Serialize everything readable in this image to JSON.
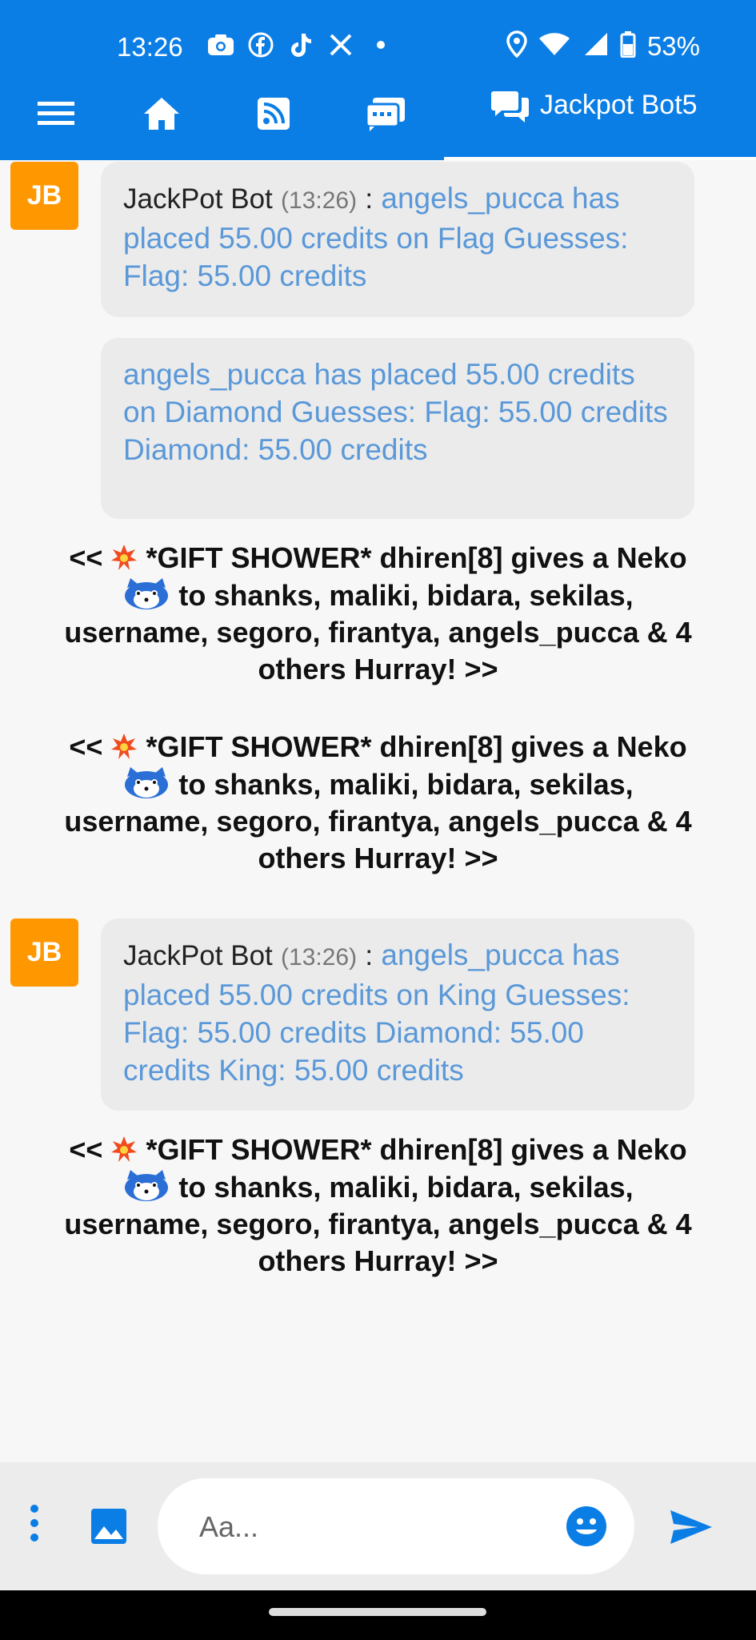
{
  "status": {
    "time": "13:26",
    "battery": "53%"
  },
  "header": {
    "room_title": "Jackpot Bot5"
  },
  "messages": [
    {
      "avatar": "JB",
      "sender": "JackPot Bot",
      "time": "(13:26)",
      "separator": ":",
      "text": "angels_pucca has placed 55.00 credits on Flag Guesses: Flag: 55.00 credits"
    },
    {
      "text": "angels_pucca has placed 55.00 credits on Diamond Guesses: Flag: 55.00 credits Diamond: 55.00 credits"
    },
    {
      "prefix": "<<",
      "text1": "*GIFT SHOWER* dhiren[8] gives a Neko",
      "text2": "to shanks, maliki, bidara, sekilas, username, segoro, firantya, angels_pucca & 4 others Hurray! >>"
    },
    {
      "prefix": "<<",
      "text1": "*GIFT SHOWER* dhiren[8] gives a Neko",
      "text2": "to shanks, maliki, bidara, sekilas, username, segoro, firantya, angels_pucca & 4 others Hurray! >>"
    },
    {
      "avatar": "JB",
      "sender": "JackPot Bot",
      "time": "(13:26)",
      "separator": ":",
      "text": "angels_pucca has placed 55.00 credits on King Guesses: Flag: 55.00 credits Diamond: 55.00 credits King: 55.00 credits"
    },
    {
      "prefix": "<<",
      "text1": "*GIFT SHOWER* dhiren[8] gives a Neko",
      "text2": "to shanks, maliki, bidara, sekilas, username, segoro, firantya, angels_pucca & 4 others Hurray! >>"
    }
  ],
  "composer": {
    "placeholder": "Aa..."
  },
  "colors": {
    "accent": "#0b7ee6",
    "avatar": "#ff9800",
    "bot_text": "#5a98d8"
  }
}
